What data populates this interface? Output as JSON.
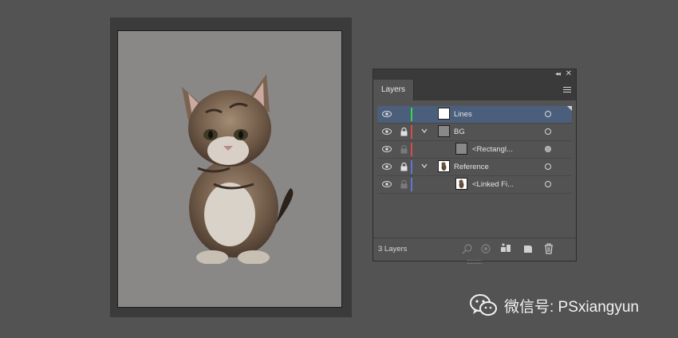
{
  "panel": {
    "tab_label": "Layers",
    "layer_count": "3 Layers",
    "rows": [
      {
        "name": "Lines",
        "color": "#38d84a",
        "selected": true,
        "locked": false,
        "expanded": false,
        "thumb": "white",
        "target_filled": false
      },
      {
        "name": "BG",
        "color": "#d94c4c",
        "selected": false,
        "locked": true,
        "expanded": true,
        "thumb": "gray",
        "target_filled": false
      },
      {
        "name": "<Rectangl...",
        "color": "#d94c4c",
        "selected": false,
        "locked": false,
        "expanded": false,
        "thumb": "gray",
        "target_filled": true
      },
      {
        "name": "Reference",
        "color": "#5b79d4",
        "selected": false,
        "locked": true,
        "expanded": true,
        "thumb": "cat",
        "target_filled": false
      },
      {
        "name": "<Linked Fi...",
        "color": "#5b79d4",
        "selected": false,
        "locked": false,
        "expanded": false,
        "thumb": "cat",
        "target_filled": false
      }
    ]
  },
  "watermark": {
    "text": "微信号: PSxiangyun"
  },
  "colors": {
    "background": "#535353",
    "artboard": "#8a8787",
    "selection": "#4b5f7c"
  }
}
